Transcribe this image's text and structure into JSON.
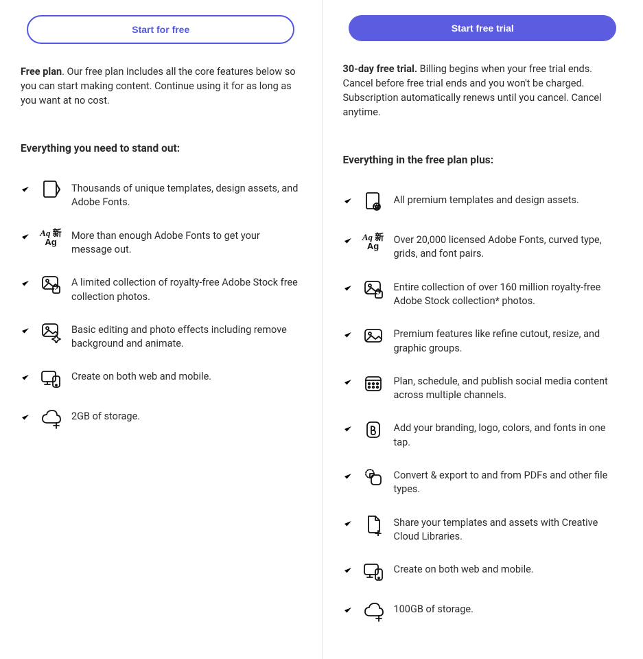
{
  "left": {
    "button": "Start for free",
    "desc_bold": "Free plan",
    "desc_rest": ". Our free plan includes all the core features below so you can start making content. Continue using it for as long as you want at no cost.",
    "heading": "Everything you need to stand out:",
    "features": [
      "Thousands of unique templates, design assets, and Adobe Fonts.",
      "More than enough Adobe Fonts to get your message out.",
      "A limited collection of royalty-free Adobe Stock free collection photos.",
      "Basic editing and photo effects including remove background and animate.",
      "Create on both web and mobile.",
      "2GB of storage."
    ]
  },
  "right": {
    "button": "Start free trial",
    "desc_bold": "30-day free trial.",
    "desc_rest": " Billing begins when your free trial ends. Cancel before free trial ends and you won't be charged. Subscription automatically renews until you cancel. Cancel anytime.",
    "heading": "Everything in the free plan plus:",
    "features": [
      "All premium templates and design assets.",
      "Over 20,000 licensed Adobe Fonts, curved type, grids, and font pairs.",
      "Entire collection of over 160 million royalty-free Adobe Stock collection* photos.",
      "Premium features like refine cutout, resize, and graphic groups.",
      "Plan, schedule, and publish social media content across multiple channels.",
      "Add your branding, logo, colors, and fonts in one tap.",
      "Convert & export to and from PDFs and other file types.",
      "Share your templates and assets with Creative Cloud Libraries.",
      "Create on both web and mobile.",
      "100GB of storage."
    ]
  }
}
